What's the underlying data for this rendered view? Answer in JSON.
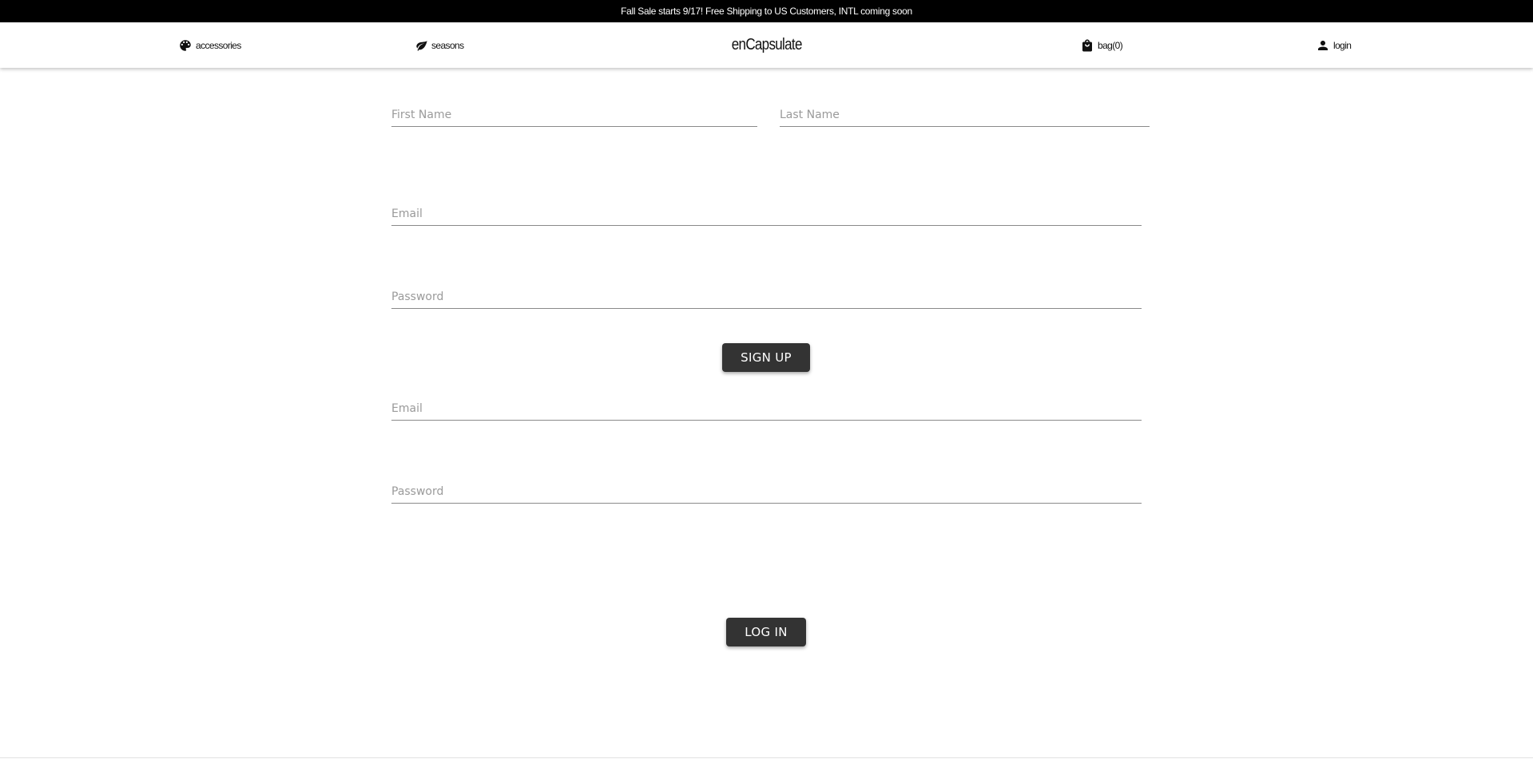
{
  "announcement": "Fall Sale starts 9/17! Free Shipping to US Customers, INTL coming soon",
  "nav": {
    "accessories": {
      "label": "accessories",
      "icon": "palette-icon"
    },
    "seasons": {
      "label": "seasons",
      "icon": "leaf-icon"
    },
    "brand": "enCapsulate",
    "bag": {
      "label": "bag(0)",
      "icon": "shopping-bag-icon"
    },
    "login": {
      "label": "login",
      "icon": "person-icon"
    }
  },
  "signup": {
    "first_name_placeholder": "First Name",
    "last_name_placeholder": "Last Name",
    "email_placeholder": "Email",
    "password_placeholder": "Password",
    "button_label": "SIGN UP"
  },
  "login": {
    "email_placeholder": "Email",
    "password_placeholder": "Password",
    "button_label": "LOG IN"
  },
  "colors": {
    "announcement_bg": "#000000",
    "button_bg": "#333333",
    "underline": "#8a8a8a",
    "placeholder": "#9a9a9a"
  }
}
